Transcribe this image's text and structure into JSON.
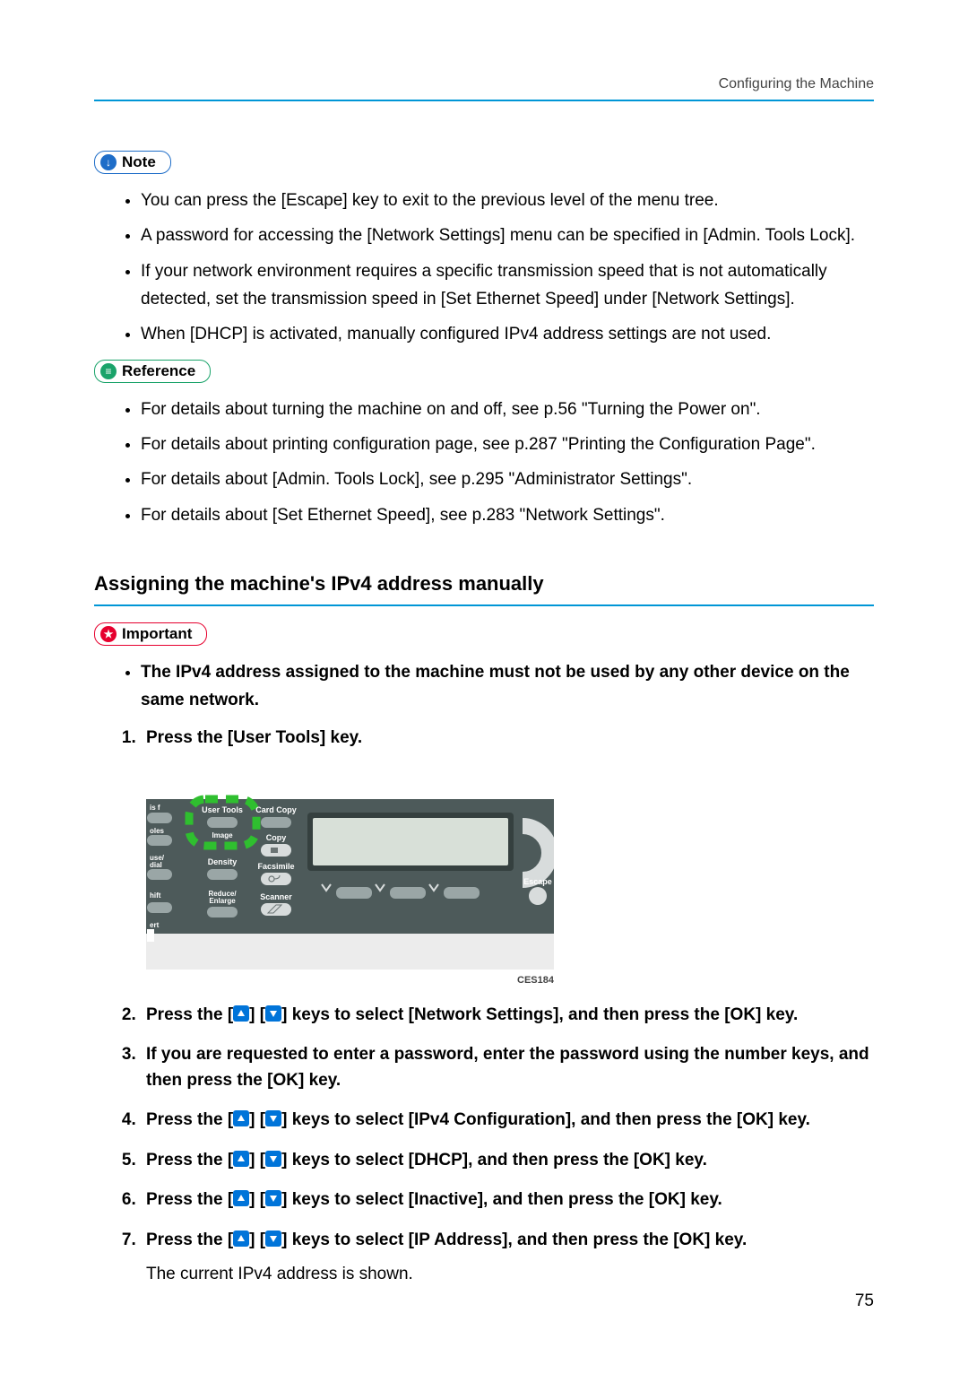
{
  "header": {
    "title": "Configuring the Machine"
  },
  "note": {
    "label": "Note",
    "items": [
      "You can press the [Escape] key to exit to the previous level of the menu tree.",
      "A password for accessing the [Network Settings] menu can be specified in [Admin. Tools Lock].",
      "If your network environment requires a specific transmission speed that is not automatically detected, set the transmission speed in [Set Ethernet Speed] under [Network Settings].",
      "When [DHCP] is activated, manually configured IPv4 address settings are not used."
    ]
  },
  "reference": {
    "label": "Reference",
    "items": [
      "For details about turning the machine on and off, see p.56 \"Turning the Power on\".",
      "For details about printing configuration page, see p.287 \"Printing the Configuration Page\".",
      "For details about [Admin. Tools Lock], see p.295 \"Administrator Settings\".",
      "For details about [Set Ethernet Speed], see p.283 \"Network Settings\"."
    ]
  },
  "section_heading": "Assigning the machine's IPv4 address manually",
  "important": {
    "label": "Important",
    "items": [
      "The IPv4 address assigned to the machine must not be used by any other device on the same network."
    ]
  },
  "steps": {
    "s1": {
      "text": "Press the [User Tools] key."
    },
    "s2": {
      "pre": "Press the [",
      "mid": "] [",
      "post": "] keys to select [Network Settings], and then press the [OK] key."
    },
    "s3": {
      "text": "If you are requested to enter a password, enter the password using the number keys, and then press the [OK] key."
    },
    "s4": {
      "pre": "Press the [",
      "mid": "] [",
      "post": "] keys to select [IPv4 Configuration], and then press the [OK] key."
    },
    "s5": {
      "pre": "Press the [",
      "mid": "] [",
      "post": "] keys to select [DHCP], and then press the [OK] key."
    },
    "s6": {
      "pre": "Press the [",
      "mid": "] [",
      "post": "] keys to select [Inactive], and then press the [OK] key."
    },
    "s7": {
      "pre": "Press the [",
      "mid": "] [",
      "post": "] keys to select [IP Address], and then press the [OK] key.",
      "sub": "The current IPv4 address is shown."
    }
  },
  "figure": {
    "id": "CES184",
    "panel": {
      "labels": {
        "user_tools": "User Tools",
        "image": "Image",
        "density": "Density",
        "reduce": "Reduce/\nEnlarge",
        "card_copy": "Card Copy",
        "copy": "Copy",
        "facsimile": "Facsimile",
        "scanner": "Scanner",
        "escape": "Escape",
        "use_dial": "use/\ndial",
        "hift": "hift",
        "ert": "ert"
      }
    }
  },
  "page_number": "75"
}
